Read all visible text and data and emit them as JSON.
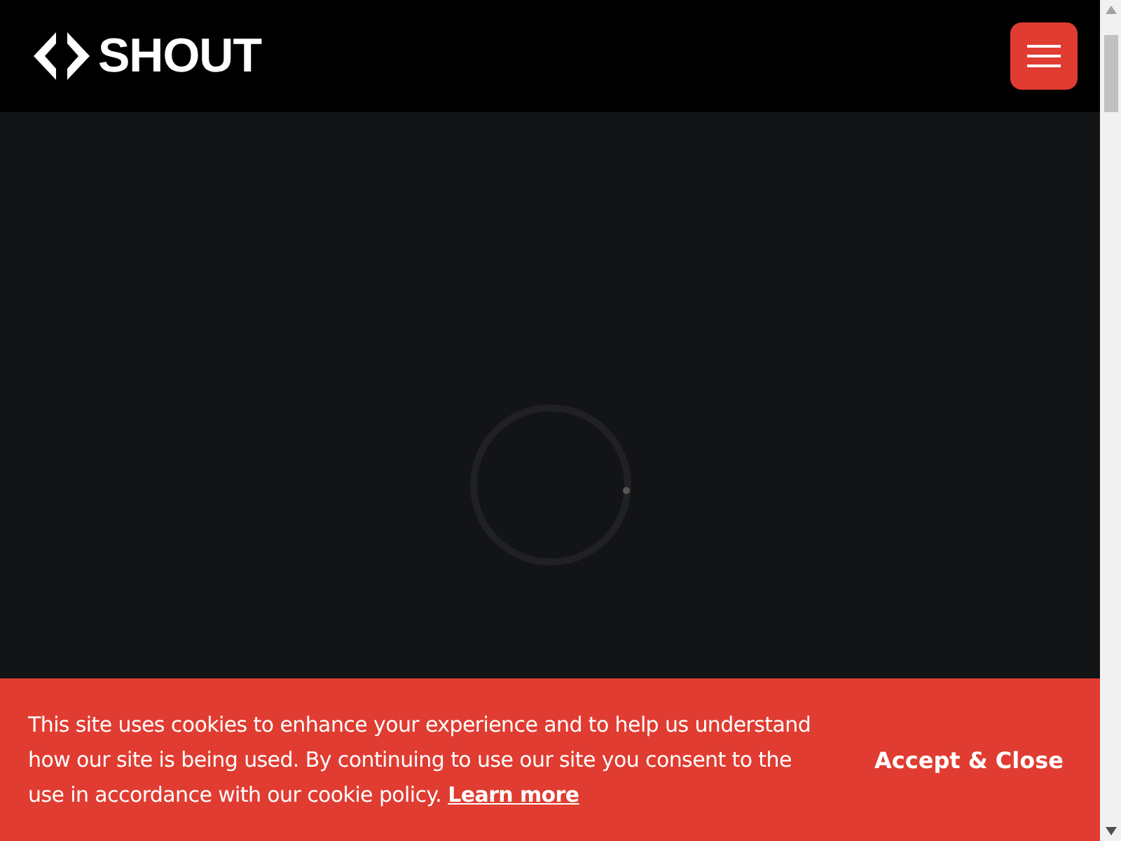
{
  "header": {
    "logo_text": "SHOUT"
  },
  "cookie_banner": {
    "message": "This site uses cookies to enhance your experience and to help us understand how our site is being used. By continuing to use our site you consent to the use in accordance with our cookie policy.",
    "link": "Learn more",
    "button": "Accept & Close"
  }
}
